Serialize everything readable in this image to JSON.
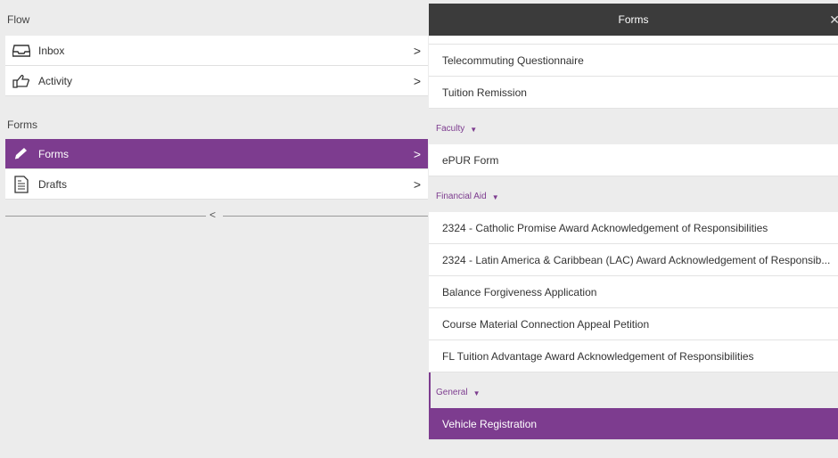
{
  "left": {
    "flow_label": "Flow",
    "flow_items": [
      {
        "label": "Inbox",
        "icon": "inbox-icon"
      },
      {
        "label": "Activity",
        "icon": "thumb-pointer-icon"
      }
    ],
    "forms_label": "Forms",
    "forms_items": [
      {
        "label": "Forms",
        "icon": "pencil-icon",
        "active": true
      },
      {
        "label": "Drafts",
        "icon": "document-icon",
        "active": false
      }
    ],
    "chevron": ">",
    "collapse_glyph": "<"
  },
  "right": {
    "title": "Forms",
    "close_glyph": "✕",
    "top_items": [
      "Telecommuting Questionnaire",
      "Tuition Remission"
    ],
    "categories": [
      {
        "name": "Faculty",
        "items": [
          "ePUR Form"
        ]
      },
      {
        "name": "Financial Aid",
        "items": [
          "2324 - Catholic Promise Award Acknowledgement of Responsibilities",
          "2324 - Latin America & Caribbean (LAC) Award Acknowledgement of Responsib...",
          "Balance Forgiveness Application",
          "Course Material Connection Appeal Petition",
          "FL Tuition Advantage Award Acknowledgement of Responsibilities"
        ]
      },
      {
        "name": "General",
        "items": [
          "Vehicle Registration"
        ]
      }
    ],
    "caret": "▼"
  },
  "colors": {
    "accent": "#7d3c8f",
    "header": "#3b3b3b",
    "background": "#ececec"
  }
}
